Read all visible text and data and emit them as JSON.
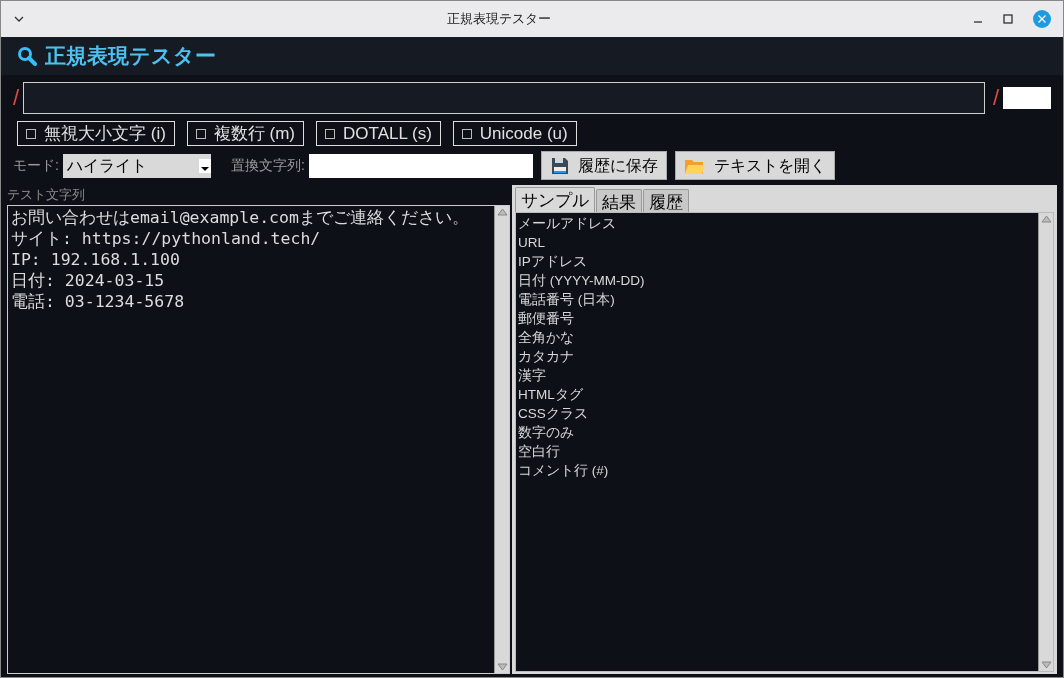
{
  "window": {
    "title": "正規表現テスター"
  },
  "header": {
    "title": "正規表現テスター"
  },
  "regex": {
    "delimiter_left": "/",
    "delimiter_right": "/"
  },
  "flags": [
    {
      "label": "無視大小文字 (i)",
      "checked": false
    },
    {
      "label": "複数行 (m)",
      "checked": false
    },
    {
      "label": "DOTALL (s)",
      "checked": false
    },
    {
      "label": "Unicode (u)",
      "checked": false
    }
  ],
  "mode": {
    "label": "モード:",
    "value": "ハイライト"
  },
  "replace": {
    "label": "置換文字列:"
  },
  "buttons": [
    {
      "label": "履歴に保存",
      "kind": "save"
    },
    {
      "label": "テキストを開く",
      "kind": "open"
    }
  ],
  "test_text": {
    "label": "テスト文字列",
    "lines": [
      "お問い合わせはemail@example.comまでご連絡ください。",
      "サイト: https://pythonland.tech/",
      "IP: 192.168.1.100",
      "日付: 2024-03-15",
      "電話: 03-1234-5678"
    ]
  },
  "tabs": [
    {
      "label": "サンプル",
      "selected": true
    },
    {
      "label": "結果",
      "selected": false
    },
    {
      "label": "履歴",
      "selected": false
    }
  ],
  "samples": [
    "メールアドレス",
    "URL",
    "IPアドレス",
    "日付 (YYYY-MM-DD)",
    "電話番号 (日本)",
    "郵便番号",
    "全角かな",
    "カタカナ",
    "漢字",
    "HTMLタグ",
    "CSSクラス",
    "数字のみ",
    "空白行",
    "コメント行 (#)"
  ]
}
